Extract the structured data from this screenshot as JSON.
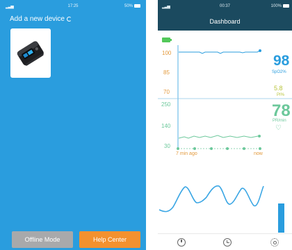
{
  "left_screen": {
    "status_bar": {
      "time": "17:25",
      "battery": "50%"
    },
    "title": "Add a new device",
    "buttons": {
      "offline": "Offline Mode",
      "help": "Help Center"
    }
  },
  "right_screen": {
    "status_bar": {
      "time": "00:37",
      "battery": "100%"
    },
    "header": {
      "title": "Dashboard"
    },
    "spo2_chart": {
      "y_ticks": [
        "100",
        "85",
        "70"
      ]
    },
    "pr_chart": {
      "y_ticks": [
        "250",
        "140",
        "30"
      ]
    },
    "time_axis": {
      "start": "7 min ago",
      "end": "now"
    },
    "readings": {
      "spo2": {
        "value": "98",
        "unit": "SpO2%"
      },
      "pi": {
        "value": "5.8",
        "unit": "PI%"
      },
      "pr": {
        "value": "78",
        "unit": "PR/min"
      }
    },
    "colors": {
      "header": "#1b4a5f",
      "spo2": "#2a9dde",
      "pi": "#b8c43a",
      "pr": "#6cc89b",
      "axis": "#e39a3d"
    }
  }
}
